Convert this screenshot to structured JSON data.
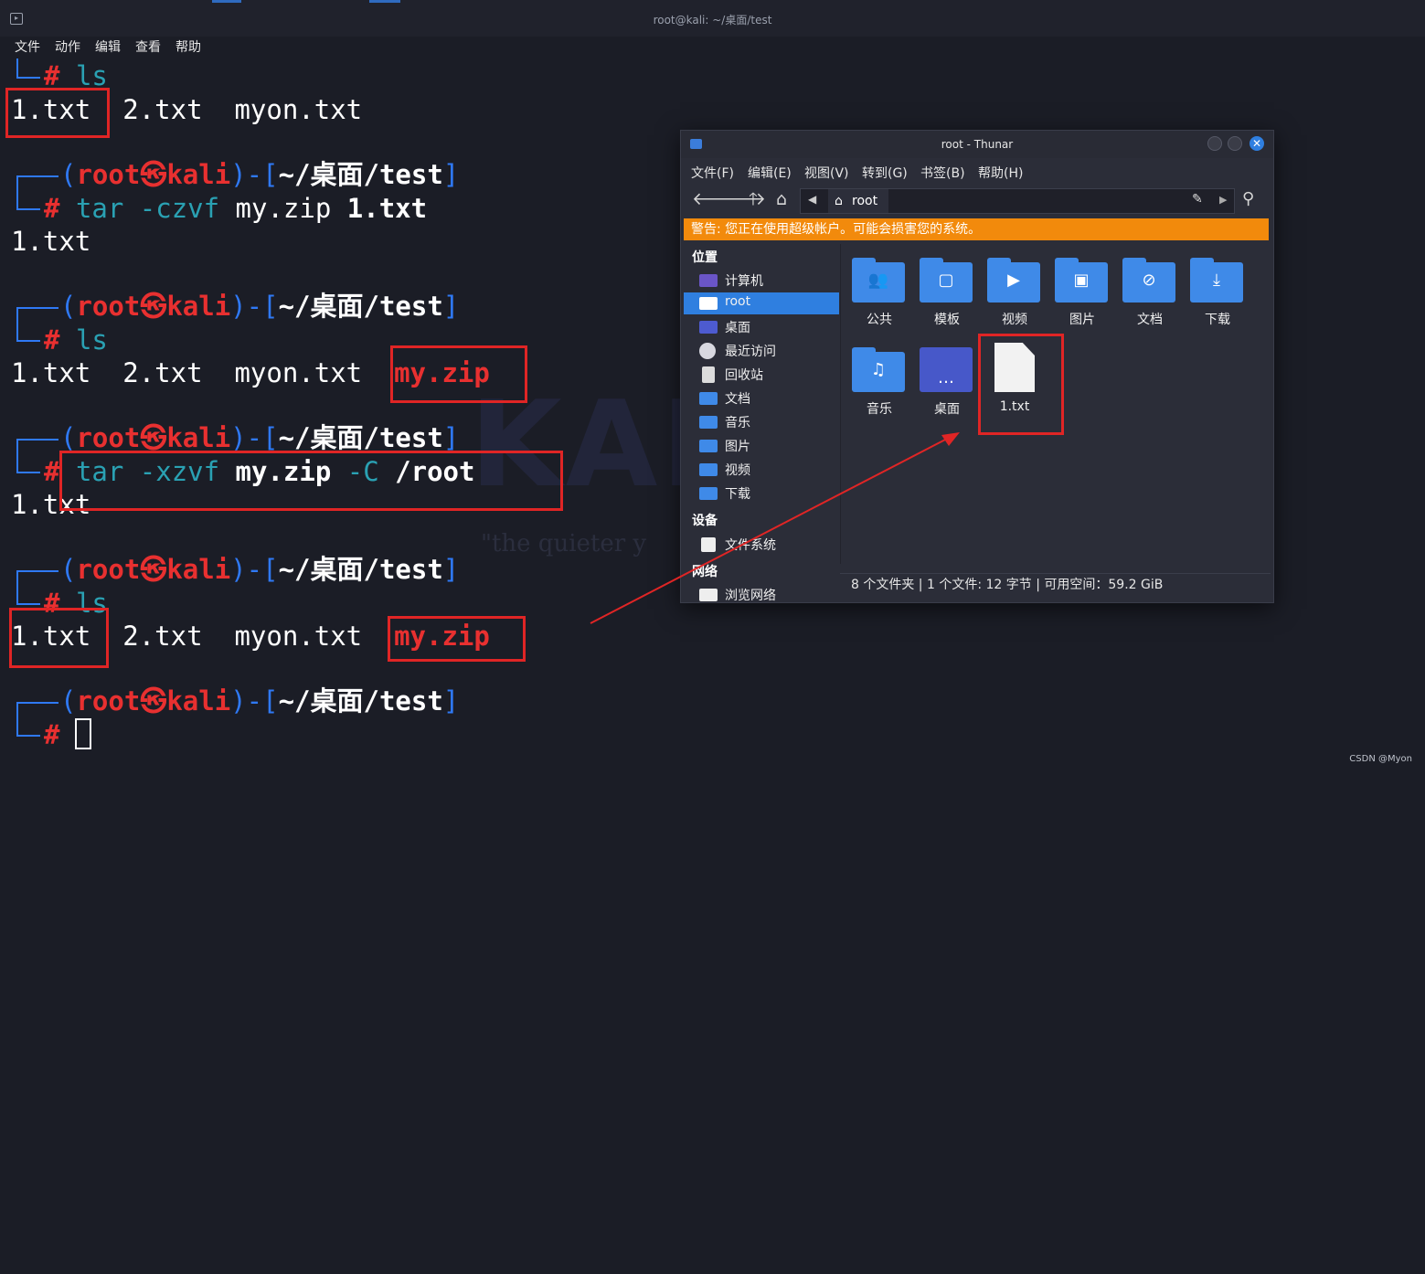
{
  "terminal": {
    "window_title": "root@kali: ~/桌面/test",
    "menu": [
      "文件",
      "动作",
      "编辑",
      "查看",
      "帮助"
    ],
    "user": "root",
    "skull": "㉿",
    "host": "kali",
    "path": "~/桌面/test",
    "hash": "#",
    "cmd_ls": "ls",
    "cmd_tar_c": "tar -czvf",
    "cmd_tar_c_zip": "my.zip",
    "cmd_tar_c_file": "1.txt",
    "cmd_tar_x": "tar -xzvf",
    "cmd_tar_x_zip": "my.zip",
    "cmd_tar_x_flag": "-C",
    "cmd_tar_x_dir": "/root",
    "files": [
      "1.txt",
      "2.txt",
      "myon.txt",
      "my.zip"
    ],
    "output_1txt": "1.txt",
    "watermark_text": "KALI",
    "watermark_tagline": "\"the quieter y"
  },
  "thunar": {
    "title": "root - Thunar",
    "close_glyph": "✕",
    "menu": [
      "文件(F)",
      "编辑(E)",
      "视图(V)",
      "转到(G)",
      "书签(B)",
      "帮助(H)"
    ],
    "path_segment": "root",
    "warning": "警告: 您正在使用超级帐户。可能会损害您的系统。",
    "sidebar": {
      "places_header": "位置",
      "places": [
        "计算机",
        "root",
        "桌面",
        "最近访问",
        "回收站",
        "文档",
        "音乐",
        "图片",
        "视频",
        "下载"
      ],
      "devices_header": "设备",
      "devices": [
        "文件系统"
      ],
      "network_header": "网络",
      "network": [
        "浏览网络"
      ]
    },
    "folders": [
      "公共",
      "模板",
      "视频",
      "图片",
      "文档",
      "下载",
      "音乐",
      "桌面"
    ],
    "file": "1.txt",
    "status": "8 个文件夹  |  1 个文件: 12 字节  |  可用空间：59.2 GiB"
  },
  "watermark": "CSDN @Myon⁠"
}
